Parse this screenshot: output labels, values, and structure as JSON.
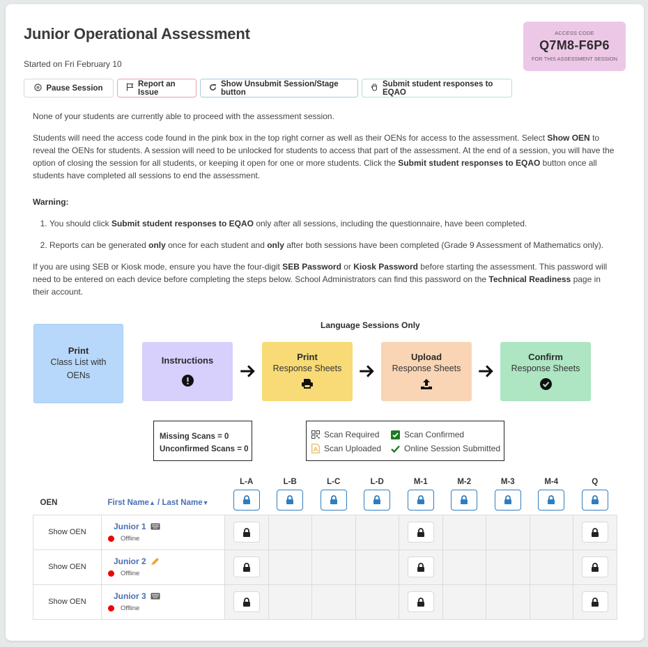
{
  "header": {
    "title": "Junior Operational Assessment",
    "started": "Started on Fri February 10"
  },
  "access_code": {
    "label": "ACCESS CODE",
    "code": "Q7M8-F6P6",
    "sublabel": "FOR THIS ASSESSMENT SESSION",
    "color": "#ecc8e6"
  },
  "toolbar": {
    "pause": "Pause Session",
    "report": "Report an Issue",
    "unsubmit": "Show Unsubmit Session/Stage button",
    "submit": "Submit student responses to EQAO"
  },
  "info": {
    "status_line": "None of your students are currently able to proceed with the assessment session.",
    "p1_a": "Students will need the access code found in the pink box in the top right corner as well as their OENs for access to the assessment. Select ",
    "p1_b": "Show OEN",
    "p1_c": " to reveal the OENs for students. A session will need to be unlocked for students to access that part of the assessment. At the end of a session, you will have the option of closing the session for all students, or keeping it open for one or more students. Click the ",
    "p1_d": "Submit student responses to EQAO",
    "p1_e": " button once all students have completed all sessions to end the assessment.",
    "warning_title": "Warning:",
    "w1_a": "You should click ",
    "w1_b": "Submit student responses to EQAO",
    "w1_c": " only after all sessions, including the questionnaire, have been completed.",
    "w2_a": "Reports can be generated ",
    "w2_b": "only",
    "w2_c": " once for each student and ",
    "w2_d": "only",
    "w2_e": " after both sessions have been completed (Grade 9 Assessment of Mathematics only).",
    "p2_a": "If you are using SEB or Kiosk mode, ensure you have the four-digit ",
    "p2_b": "SEB Password",
    "p2_c": " or ",
    "p2_d": "Kiosk Password",
    "p2_e": " before starting the assessment. This password will need to be entered on each device before completing the steps below. School Administrators can find this password on the ",
    "p2_f": "Technical Readiness",
    "p2_g": " page in their account."
  },
  "steps": {
    "section_label": "Language Sessions Only",
    "print_list": {
      "title": "Print",
      "sub": "Class List with OENs"
    },
    "instructions": {
      "title": "Instructions",
      "icon": "exclamation-circle-icon"
    },
    "print_rs": {
      "title": "Print",
      "sub": "Response Sheets",
      "icon": "print-icon"
    },
    "upload_rs": {
      "title": "Upload",
      "sub": "Response Sheets",
      "icon": "upload-icon"
    },
    "confirm_rs": {
      "title": "Confirm",
      "sub": "Response Sheets",
      "icon": "check-circle-icon"
    }
  },
  "scan_counts": {
    "missing": "Missing Scans = 0",
    "unconfirmed": "Unconfirmed Scans = 0"
  },
  "legend": {
    "scan_required": "Scan Required",
    "scan_confirmed": "Scan Confirmed",
    "scan_uploaded": "Scan Uploaded",
    "online_submitted": "Online Session Submitted"
  },
  "table": {
    "col_oen": "OEN",
    "col_first": "First Name",
    "col_sep": " / ",
    "col_last": "Last Name",
    "sessions": [
      "L-A",
      "L-B",
      "L-C",
      "L-D",
      "M-1",
      "M-2",
      "M-3",
      "M-4",
      "Q"
    ],
    "rows": [
      {
        "oen": "Show OEN",
        "name": "Junior 1",
        "mode_icon": "keyboard-icon",
        "status": "Offline"
      },
      {
        "oen": "Show OEN",
        "name": "Junior 2",
        "mode_icon": "pencil-icon",
        "status": "Offline"
      },
      {
        "oen": "Show OEN",
        "name": "Junior 3",
        "mode_icon": "keyboard-icon",
        "status": "Offline"
      }
    ],
    "locked_sessions_per_row": [
      "L-A",
      "M-1",
      "Q"
    ]
  }
}
